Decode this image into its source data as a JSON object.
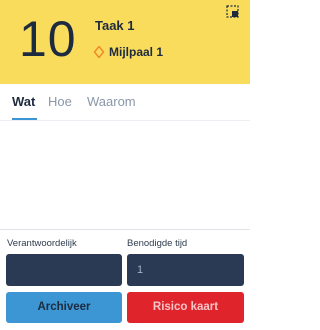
{
  "colors": {
    "header_bg": "#f9dc5c",
    "text_dark": "#1e2a3e",
    "tab_inactive": "#8a97a8",
    "accent_blue": "#3c96d4",
    "input_bg": "#2a3a55",
    "danger_red": "#e0242c",
    "milestone_icon": "#f08a2c"
  },
  "header": {
    "task_number": "10",
    "task_title": "Taak 1",
    "milestone": {
      "icon": "diamond-icon",
      "label": "Mijlpaal 1"
    },
    "corner_icon": "select-dashed-icon"
  },
  "tabs": [
    {
      "label": "Wat",
      "active": true
    },
    {
      "label": "Hoe",
      "active": false
    },
    {
      "label": "Waarom",
      "active": false
    }
  ],
  "footer": {
    "responsible": {
      "label": "Verantwoordelijk",
      "value": ""
    },
    "time_needed": {
      "label": "Benodigde tijd",
      "placeholder": "1"
    },
    "buttons": {
      "archive": "Archiveer",
      "risk_card": "Risico kaart"
    }
  }
}
